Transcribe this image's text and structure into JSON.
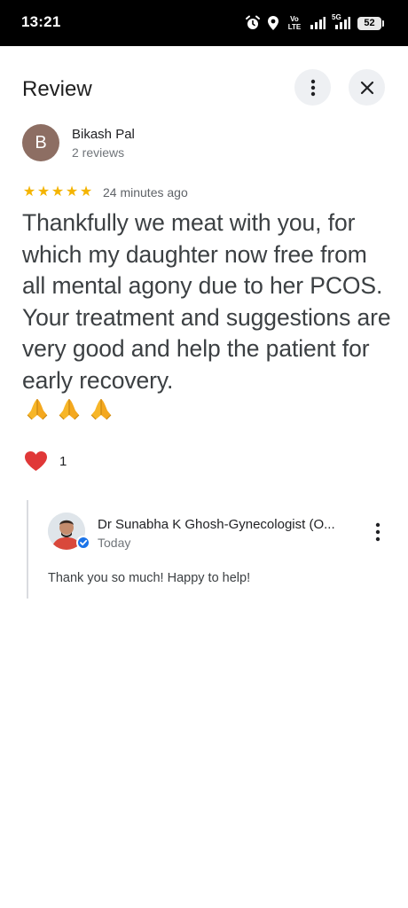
{
  "status_bar": {
    "time": "13:21",
    "icons": [
      "alarm-icon",
      "location-icon",
      "volte-icon",
      "signal-icon",
      "5g-signal-icon",
      "battery-icon"
    ],
    "volte_text": "Vo LTE",
    "net_text": "5G",
    "battery": "52"
  },
  "header": {
    "title": "Review",
    "more_icon": "more-vert-icon",
    "close_icon": "close-icon"
  },
  "review": {
    "avatar_letter": "B",
    "avatar_color": "#8d6e63",
    "reviewer_name": "Bikash Pal",
    "reviewer_count": "2 reviews",
    "rating": 5,
    "star_color": "#f4b400",
    "time": "24 minutes ago",
    "text": "Thankfully we meat with you, for which my daughter now free from all mental agony due to her PCOS. Your treatment and suggestions are very good and help the patient for early recovery.",
    "emojis": [
      "folded-hands-emoji",
      "folded-hands-emoji",
      "folded-hands-emoji"
    ],
    "like_icon": "heart-icon",
    "like_count": "1"
  },
  "owner_reply": {
    "name": "Dr Sunabha K Ghosh-Gynecologist (O...",
    "date": "Today",
    "text": "Thank you so much! Happy to help!",
    "verified_icon": "verified-badge-icon",
    "accent": "#1a73e8"
  }
}
